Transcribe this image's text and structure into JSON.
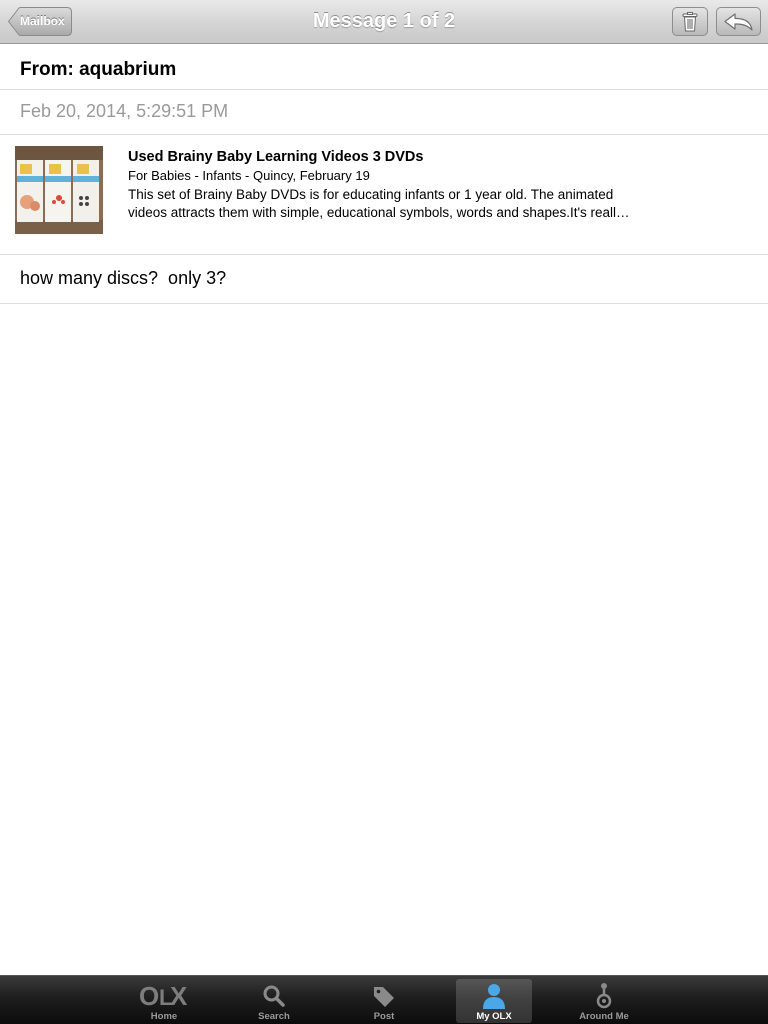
{
  "navbar": {
    "title": "Message 1 of 2",
    "back_label": "Mailbox",
    "trash_icon": "trash-icon",
    "reply_icon": "reply-arrow-icon"
  },
  "message": {
    "from": "From: aquabrium",
    "date": "Feb 20, 2014, 5:29:51 PM",
    "body": "how many discs?  only 3?"
  },
  "listing": {
    "title": "Used Brainy Baby Learning Videos 3 DVDs",
    "meta": "For Babies - Infants - Quincy, February 19",
    "desc_line1": "This set of Brainy Baby DVDs is for educating infants or 1 year old. The animated",
    "desc_line2": "videos attracts them with simple, educational symbols, words and shapes.It's reall…"
  },
  "tabbar": {
    "items": [
      {
        "label": "Home",
        "icon": "olx-logo-icon"
      },
      {
        "label": "Search",
        "icon": "magnifier-icon"
      },
      {
        "label": "Post",
        "icon": "tag-icon"
      },
      {
        "label": "My OLX",
        "icon": "person-icon"
      },
      {
        "label": "Around Me",
        "icon": "location-icon"
      }
    ],
    "active_index": 3
  },
  "colors": {
    "date_text": "#9a9a9a",
    "active_icon": "#4aa8e8",
    "navbar": "#d6d6d6"
  }
}
